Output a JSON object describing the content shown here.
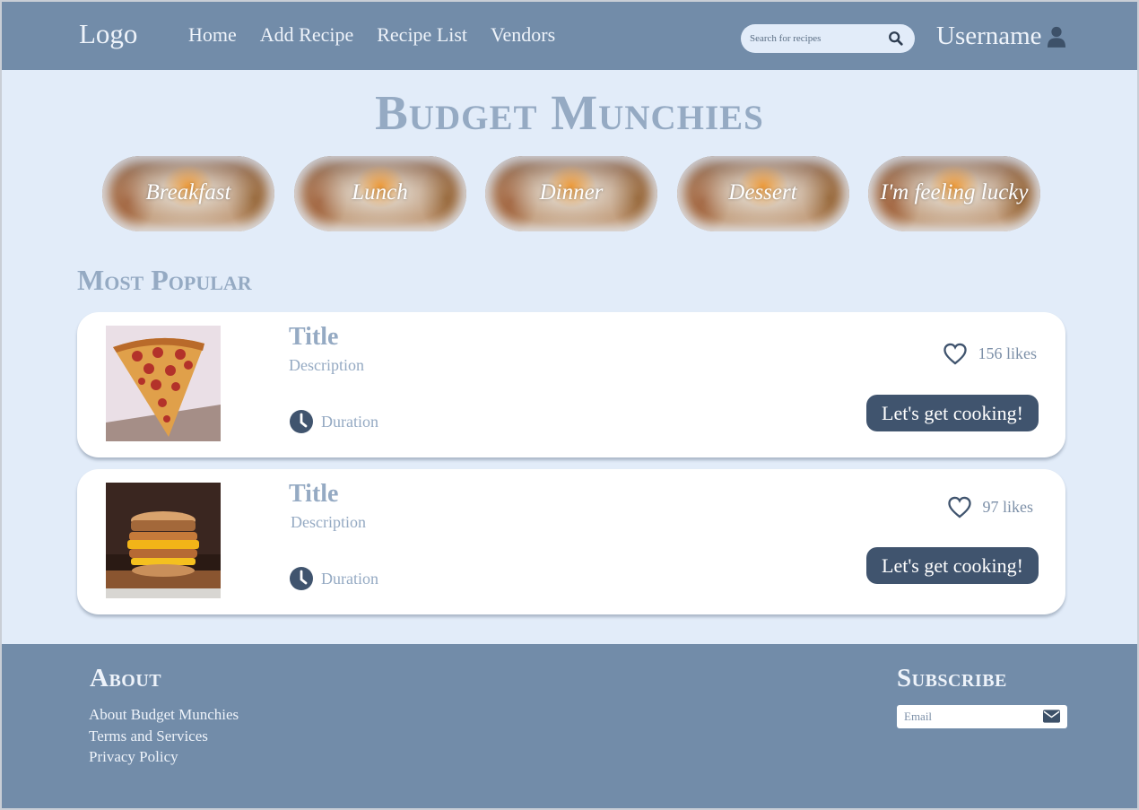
{
  "header": {
    "logo": "Logo",
    "nav": [
      "Home",
      "Add Recipe",
      "Recipe List",
      "Vendors"
    ],
    "search": {
      "placeholder": "Search for recipes",
      "icon": "search-icon"
    },
    "username": "Username",
    "user_icon": "user-icon"
  },
  "site_title": "Budget Munchies",
  "categories": [
    "Breakfast",
    "Lunch",
    "Dinner",
    "Dessert",
    "I'm feeling lucky"
  ],
  "most_popular": {
    "heading": "Most Popular",
    "recipes": [
      {
        "image": "pepperoni pizza slice",
        "title": "Title",
        "description": "Description",
        "duration": "Duration",
        "likes": "156 likes",
        "button": "Let's get cooking!"
      },
      {
        "image": "egg and cheese breakfast sandwich",
        "title": "Title",
        "description": "Description",
        "duration": "Duration",
        "likes": "97 likes",
        "button": "Let's get cooking!"
      }
    ]
  },
  "footer": {
    "about_heading": "About",
    "about_links": [
      "About Budget Munchies",
      "Terms and Services",
      "Privacy Policy"
    ],
    "subscribe_heading": "Subscribe",
    "email_placeholder": "Email",
    "email_icon": "envelope-icon"
  },
  "colors": {
    "background": "#e2ecf9",
    "header": "#728ca9",
    "title": "#95aac3",
    "button": "#40546e"
  }
}
